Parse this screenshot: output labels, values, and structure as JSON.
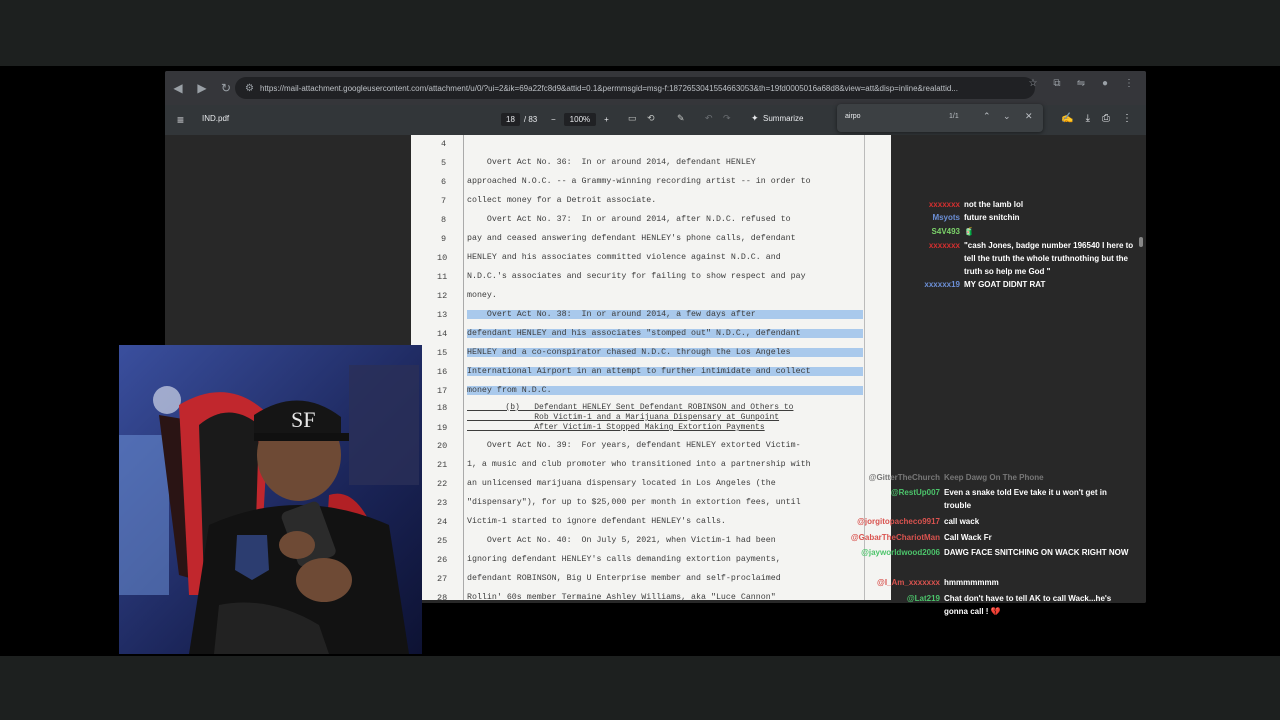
{
  "browser": {
    "url": "https://mail-attachment.googleusercontent.com/attachment/u/0/?ui=2&ik=69a22fc8d9&attid=0.1&permmsgid=msg-f:1872653041554663053&th=19fd0005016a68d8&view=att&disp=inline&realattid..."
  },
  "pdf": {
    "filename": "IND.pdf",
    "page_current": "18",
    "page_total": "/ 83",
    "zoom": "100%",
    "summarize_label": "Summarize",
    "find_query": "airpo",
    "find_count": "1/1"
  },
  "document": {
    "lines": [
      {
        "n": "4",
        "text": ""
      },
      {
        "n": "5",
        "text": "    Overt Act No. 36:  In or around 2014, defendant HENLEY"
      },
      {
        "n": "6",
        "text": "approached N.O.C. -- a Grammy-winning recording artist -- in order to"
      },
      {
        "n": "7",
        "text": "collect money for a Detroit associate."
      },
      {
        "n": "8",
        "text": "    Overt Act No. 37:  In or around 2014, after N.D.C. refused to"
      },
      {
        "n": "9",
        "text": "pay and ceased answering defendant HENLEY's phone calls, defendant"
      },
      {
        "n": "10",
        "text": "HENLEY and his associates committed violence against N.D.C. and"
      },
      {
        "n": "11",
        "text": "N.D.C.'s associates and security for failing to show respect and pay"
      },
      {
        "n": "12",
        "text": "money."
      },
      {
        "n": "13",
        "text": "    Overt Act No. 38:  In or around 2014, a few days after"
      },
      {
        "n": "14",
        "text": "defendant HENLEY and his associates \"stomped out\" N.D.C., defendant"
      },
      {
        "n": "15",
        "text": "HENLEY and a co-conspirator chased N.D.C. through the Los Angeles"
      },
      {
        "n": "16",
        "text": "International Airport in an attempt to further intimidate and collect"
      },
      {
        "n": "17",
        "text": "money from N.D.C."
      },
      {
        "n": "18",
        "text": "        (b)   Defendant HENLEY Sent Defendant ROBINSON and Others to"
      },
      {
        "n": "18b",
        "text": "              Rob Victim-1 and a Marijuana Dispensary at Gunpoint"
      },
      {
        "n": "19",
        "text": "              After Victim-1 Stopped Making Extortion Payments"
      },
      {
        "n": "20",
        "text": "    Overt Act No. 39:  For years, defendant HENLEY extorted Victim-"
      },
      {
        "n": "21",
        "text": "1, a music and club promoter who transitioned into a partnership with"
      },
      {
        "n": "22",
        "text": "an unlicensed marijuana dispensary located in Los Angeles (the"
      },
      {
        "n": "23",
        "text": "\"dispensary\"), for up to $25,000 per month in extortion fees, until"
      },
      {
        "n": "24",
        "text": "Victim-1 started to ignore defendant HENLEY's calls."
      },
      {
        "n": "25",
        "text": "    Overt Act No. 40:  On July 5, 2021, when Victim-1 had been"
      },
      {
        "n": "26",
        "text": "ignoring defendant HENLEY's calls demanding extortion payments,"
      },
      {
        "n": "27",
        "text": "defendant ROBINSON, Big U Enterprise member and self-proclaimed"
      },
      {
        "n": "28",
        "text": "Rollin' 60s member Termaine Ashley Williams, aka \"Luce Cannon\""
      }
    ]
  },
  "chat_top": [
    {
      "user": "xxxxxxx",
      "text": "not the lamb lol",
      "color": "#d32f2f"
    },
    {
      "user": "Msyots",
      "text": "future snitchin",
      "color": "#6c8fd6"
    },
    {
      "user": "S4V493",
      "text": "🧃",
      "color": "#7cd36a"
    },
    {
      "user": "xxxxxxx",
      "text": "\"cash Jones, badge number 196540 I here to tell the truth the whole truthnothing but the truth so help me God \"",
      "color": "#d32f2f"
    },
    {
      "user": "xxxxxx19",
      "text": "MY GOAT DIDNT RAT",
      "color": "#6c8fd6"
    }
  ],
  "chat_bottom": [
    {
      "user": "@GitterTheChurch",
      "text": "Keep Dawg On The Phone",
      "color": "#777777"
    },
    {
      "user": "@RestUp007",
      "text": "Even a snake told Eve take it u won't get in trouble",
      "color": "#4cc46b"
    },
    {
      "user": "@jorgitopacheco9917",
      "text": "call wack",
      "color": "#d9534f"
    },
    {
      "user": "@GabarTheChariotMan",
      "text": "Call Wack Fr",
      "color": "#d9534f"
    },
    {
      "user": "@jayworldwood2006",
      "text": "DAWG FACE SNITCHING ON WACK RIGHT NOW",
      "color": "#4cc46b"
    },
    {
      "user": "@I_Am_xxxxxxx",
      "text": "hmmmmmmm",
      "color": "#d9534f"
    },
    {
      "user": "@Lat219",
      "text": "Chat don't have to tell AK to call Wack...he's gonna call ! 💔",
      "color": "#4cc46b"
    }
  ]
}
